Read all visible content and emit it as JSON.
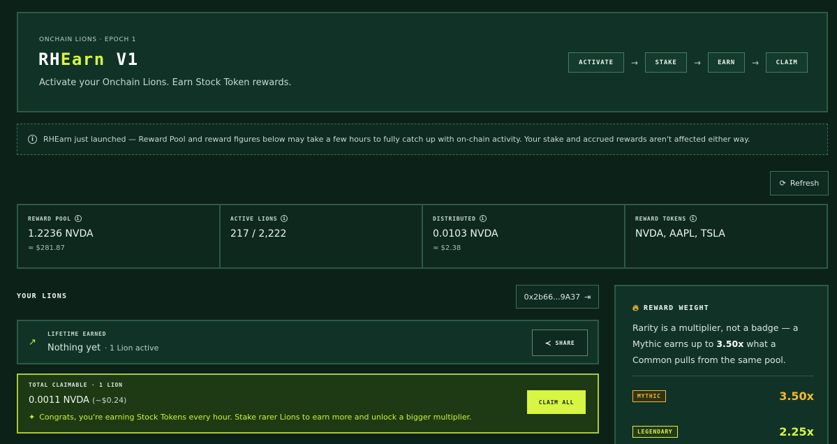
{
  "header": {
    "eyebrow": "ONCHAIN LIONS · EPOCH 1",
    "title_prefix": "RH",
    "title_accent": "Earn",
    "title_suffix": " V1",
    "subtitle": "Activate your Onchain Lions. Earn Stock Token rewards.",
    "steps": [
      "ACTIVATE",
      "STAKE",
      "EARN",
      "CLAIM"
    ]
  },
  "notice": {
    "text": "RHEarn just launched — Reward Pool and reward figures below may take a few hours to fully catch up with on-chain activity. Your stake and accrued rewards aren't affected either way."
  },
  "refresh": {
    "label": "Refresh"
  },
  "stats": [
    {
      "label": "REWARD POOL",
      "value": "1.2236 NVDA",
      "usd": "≈ $281.87"
    },
    {
      "label": "ACTIVE LIONS",
      "value": "217 / 2,222",
      "usd": ""
    },
    {
      "label": "DISTRIBUTED",
      "value": "0.0103 NVDA",
      "usd": "≈ $2.38"
    },
    {
      "label": "REWARD TOKENS",
      "value": "NVDA, AAPL, TSLA",
      "usd": ""
    }
  ],
  "your_lions": {
    "title": "YOUR LIONS",
    "wallet": "0x2b66...9A37",
    "lifetime_label": "LIFETIME EARNED",
    "lifetime_value": "Nothing yet",
    "lifetime_note": "· 1 Lion active",
    "share_label": "SHARE",
    "claimable_label": "TOTAL CLAIMABLE · 1 LION",
    "claimable_value": "0.0011 NVDA",
    "claimable_usd": "(~$0.24)",
    "claim_all_label": "CLAIM ALL",
    "congrats": "Congrats, you're earning Stock Tokens every hour. Stake rarer Lions to earn more and unlock a bigger multiplier."
  },
  "reward_weight": {
    "title": "REWARD WEIGHT",
    "desc_1": "Rarity is a multiplier, not a badge — a Mythic earns up to ",
    "desc_bold": "3.50x",
    "desc_2": " what a Common pulls from the same pool.",
    "tiers": [
      {
        "name": "MYTHIC",
        "multiplier": "3.50x",
        "color": "#f5b82e"
      },
      {
        "name": "LEGENDARY",
        "multiplier": "2.25x",
        "color": "#d7f542"
      }
    ]
  },
  "colors": {
    "background": "#0c2219",
    "accent": "#d7f542",
    "mythic": "#f5b82e"
  }
}
